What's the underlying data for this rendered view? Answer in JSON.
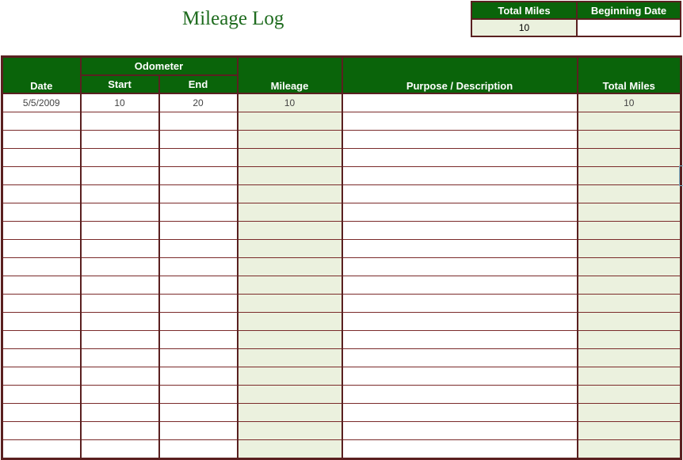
{
  "title": "Mileage Log",
  "summary": {
    "total_miles_label": "Total Miles",
    "beginning_date_label": "Beginning Date",
    "total_miles_value": "10",
    "beginning_date_value": ""
  },
  "log": {
    "headers": {
      "date": "Date",
      "odometer": "Odometer",
      "start": "Start",
      "end": "End",
      "mileage": "Mileage",
      "purpose": "Purpose / Description",
      "total_miles": "Total Miles"
    },
    "rows": [
      {
        "date": "5/5/2009",
        "start": "10",
        "end": "20",
        "mileage": "10",
        "purpose": "",
        "total": "10"
      },
      {
        "date": "",
        "start": "",
        "end": "",
        "mileage": "",
        "purpose": "",
        "total": ""
      },
      {
        "date": "",
        "start": "",
        "end": "",
        "mileage": "",
        "purpose": "",
        "total": ""
      },
      {
        "date": "",
        "start": "",
        "end": "",
        "mileage": "",
        "purpose": "",
        "total": ""
      },
      {
        "date": "",
        "start": "",
        "end": "",
        "mileage": "",
        "purpose": "",
        "total": ""
      },
      {
        "date": "",
        "start": "",
        "end": "",
        "mileage": "",
        "purpose": "",
        "total": ""
      },
      {
        "date": "",
        "start": "",
        "end": "",
        "mileage": "",
        "purpose": "",
        "total": ""
      },
      {
        "date": "",
        "start": "",
        "end": "",
        "mileage": "",
        "purpose": "",
        "total": ""
      },
      {
        "date": "",
        "start": "",
        "end": "",
        "mileage": "",
        "purpose": "",
        "total": ""
      },
      {
        "date": "",
        "start": "",
        "end": "",
        "mileage": "",
        "purpose": "",
        "total": ""
      },
      {
        "date": "",
        "start": "",
        "end": "",
        "mileage": "",
        "purpose": "",
        "total": ""
      },
      {
        "date": "",
        "start": "",
        "end": "",
        "mileage": "",
        "purpose": "",
        "total": ""
      },
      {
        "date": "",
        "start": "",
        "end": "",
        "mileage": "",
        "purpose": "",
        "total": ""
      },
      {
        "date": "",
        "start": "",
        "end": "",
        "mileage": "",
        "purpose": "",
        "total": ""
      },
      {
        "date": "",
        "start": "",
        "end": "",
        "mileage": "",
        "purpose": "",
        "total": ""
      },
      {
        "date": "",
        "start": "",
        "end": "",
        "mileage": "",
        "purpose": "",
        "total": ""
      },
      {
        "date": "",
        "start": "",
        "end": "",
        "mileage": "",
        "purpose": "",
        "total": ""
      },
      {
        "date": "",
        "start": "",
        "end": "",
        "mileage": "",
        "purpose": "",
        "total": ""
      },
      {
        "date": "",
        "start": "",
        "end": "",
        "mileage": "",
        "purpose": "",
        "total": ""
      },
      {
        "date": "",
        "start": "",
        "end": "",
        "mileage": "",
        "purpose": "",
        "total": ""
      }
    ]
  },
  "colors": {
    "header_green": "#0a640a",
    "border_maroon": "#5a2020",
    "shaded_cell": "#ebf1de",
    "title_green": "#1e6b1e"
  }
}
